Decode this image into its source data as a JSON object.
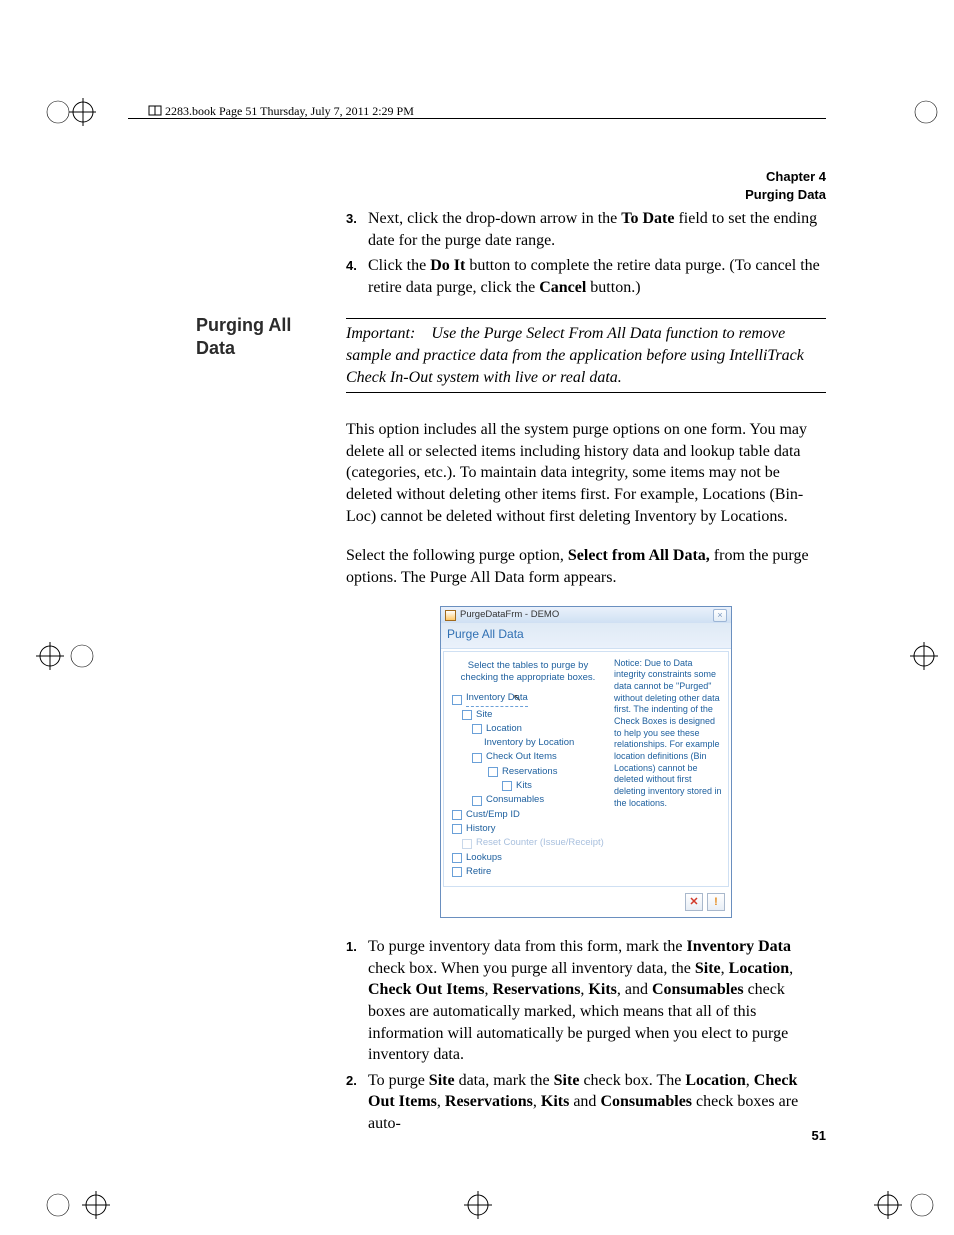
{
  "header": {
    "crop_note": "2283.book  Page 51  Thursday, July 7, 2011  2:29 PM"
  },
  "chapter": {
    "line1": "Chapter 4",
    "line2": "Purging Data"
  },
  "page_number": "51",
  "side_heading": "Purging All Data",
  "steps_top": [
    {
      "num": "3.",
      "parts": [
        "Next, click the drop-down arrow in the ",
        "To Date",
        " field to set the ending date for the purge date range."
      ]
    },
    {
      "num": "4.",
      "parts": [
        "Click the ",
        "Do It",
        " button to complete the retire data purge. (To cancel the retire data purge, click the ",
        "Cancel",
        " button.)"
      ]
    }
  ],
  "important_note": {
    "label": "Important:",
    "body": "Use the Purge Select From All Data function to remove sample and practice data from the application before using IntelliTrack Check In-Out system with live or real data."
  },
  "para1": "This option includes all the system purge options on one form. You may delete all or selected items including history data and lookup table data (categories, etc.). To maintain data integrity, some items may not be deleted without deleting other items first. For example, Locations (Bin-Loc) cannot be deleted without first deleting Inventory by Locations.",
  "para2_pre": "Select the following purge option, ",
  "para2_bold": "Select from All Data,",
  "para2_post": " from the purge options. The Purge All Data form appears.",
  "dialog": {
    "window_title": "PurgeDataFrm - DEMO",
    "form_title": "Purge All Data",
    "instruction": "Select the tables to purge by checking the appropriate boxes.",
    "checks": {
      "inventory_data": "Inventory Data",
      "site": "Site",
      "location": "Location",
      "inv_by_loc": "Inventory by Location",
      "check_out_items": "Check Out Items",
      "reservations": "Reservations",
      "kits": "Kits",
      "consumables": "Consumables",
      "cust_emp_id": "Cust/Emp ID",
      "history": "History",
      "reset_counter": "Reset Counter (Issue/Receipt)",
      "lookups": "Lookups",
      "retire": "Retire"
    },
    "notice": "Notice: Due to Data integrity constraints some data cannot be \"Purged\" without deleting other data first. The indenting of the Check Boxes is designed to help you see these relationships. For example location definitions (Bin Locations) cannot be deleted without first deleting inventory stored in the  locations.",
    "close_button": "✕",
    "exclaim_button": "!"
  },
  "steps_bottom": [
    {
      "num": "1.",
      "pieces": [
        {
          "t": "To purge inventory data from this form, mark the "
        },
        {
          "t": "Inventory Data",
          "b": true
        },
        {
          "t": " check box. When you purge all inventory data, the "
        },
        {
          "t": "Site",
          "b": true
        },
        {
          "t": ", "
        },
        {
          "t": "Location",
          "b": true
        },
        {
          "t": ", "
        },
        {
          "t": "Check Out Items",
          "b": true
        },
        {
          "t": ", "
        },
        {
          "t": "Reservations",
          "b": true
        },
        {
          "t": ", "
        },
        {
          "t": "Kits",
          "b": true
        },
        {
          "t": ", and "
        },
        {
          "t": "Consumables",
          "b": true
        },
        {
          "t": " check boxes are automatically marked, which means that all of this information will automatically be purged when you elect to purge inventory data."
        }
      ]
    },
    {
      "num": "2.",
      "pieces": [
        {
          "t": "To purge "
        },
        {
          "t": "Site",
          "b": true
        },
        {
          "t": " data, mark the "
        },
        {
          "t": "Site",
          "b": true
        },
        {
          "t": " check box. The "
        },
        {
          "t": "Location",
          "b": true
        },
        {
          "t": ", "
        },
        {
          "t": "Check Out Items",
          "b": true
        },
        {
          "t": ", "
        },
        {
          "t": "Reservations",
          "b": true
        },
        {
          "t": ", "
        },
        {
          "t": "Kits",
          "b": true
        },
        {
          "t": " and "
        },
        {
          "t": "Consumables",
          "b": true
        },
        {
          "t": " check boxes are auto-"
        }
      ]
    }
  ]
}
